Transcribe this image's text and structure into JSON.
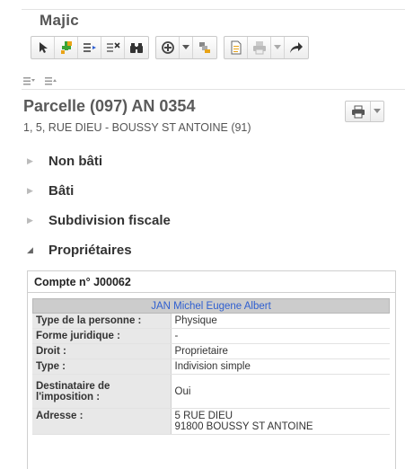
{
  "app": {
    "title": "Majic"
  },
  "toolbar": {
    "groups": [
      [
        "select-arrow-icon",
        "add-point-icon",
        "list-add-icon",
        "list-remove-icon",
        "binoculars-icon"
      ],
      [
        "target-icon",
        "chevron-down-icon",
        "layers-icon"
      ],
      [
        "document-icon",
        "printer-icon",
        "chevron-down-icon",
        "share-arrow-icon"
      ]
    ]
  },
  "parcel": {
    "title": "Parcelle (097) AN 0354",
    "address": "1, 5, RUE DIEU - BOUSSY ST ANTOINE (91)"
  },
  "sections": [
    {
      "label": "Non bâti",
      "expanded": false
    },
    {
      "label": "Bâti",
      "expanded": false
    },
    {
      "label": "Subdivision fiscale",
      "expanded": false
    },
    {
      "label": "Propriétaires",
      "expanded": true
    }
  ],
  "account": {
    "title": "Compte n° J00062",
    "owner": "JAN Michel Eugene Albert",
    "rows": [
      {
        "key": "Type de la personne :",
        "value": "Physique"
      },
      {
        "key": "Forme juridique :",
        "value": "-"
      },
      {
        "key": "Droit :",
        "value": "Proprietaire"
      },
      {
        "key": "Type :",
        "value": "Indivision simple"
      },
      {
        "key": "Destinataire de l'imposition :",
        "value": "Oui"
      },
      {
        "key": "Adresse :",
        "value": "5 RUE DIEU",
        "value2": "91800 BOUSSY ST ANTOINE"
      }
    ]
  },
  "colors": {
    "accent": "#2f5fd0",
    "icon_green": "#3aa335",
    "icon_orange": "#e8a317"
  }
}
